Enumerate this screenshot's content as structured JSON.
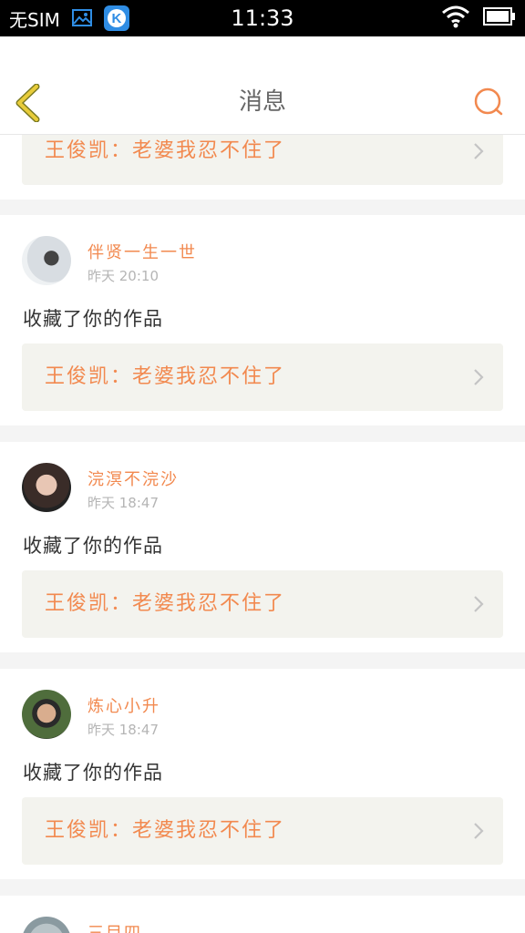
{
  "status_bar": {
    "carrier": "无SIM",
    "time": "11:33"
  },
  "nav": {
    "title": "消息"
  },
  "top_partial_card": {
    "ref_text": "王俊凯：老婆我忍不住了"
  },
  "items": [
    {
      "username": "伴贤一生一世",
      "time": "昨天 20:10",
      "action": "收藏了你的作品",
      "ref_text": "王俊凯：老婆我忍不住了"
    },
    {
      "username": "浣溟不浣沙",
      "time": "昨天 18:47",
      "action": "收藏了你的作品",
      "ref_text": "王俊凯：老婆我忍不住了"
    },
    {
      "username": "炼心小升",
      "time": "昨天 18:47",
      "action": "收藏了你的作品",
      "ref_text": "王俊凯：老婆我忍不住了"
    }
  ],
  "bottom_partial_card": {
    "username": "三目四"
  },
  "colors": {
    "accent": "#f2894f",
    "ref_bg": "#f3f3ee",
    "separator": "#f4f4f4"
  }
}
